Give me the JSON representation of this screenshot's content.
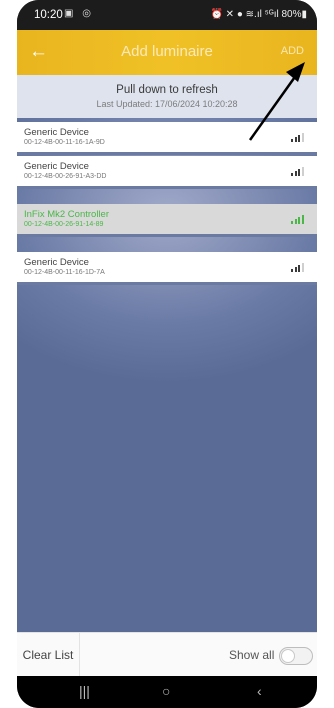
{
  "status_bar": {
    "time": "10:20",
    "icons_left": "▣ ◎",
    "icons_right": "⏰ ✕ ● ≋.ıl ⁵ᴳıl 80%▮",
    "battery": "80%"
  },
  "app_bar": {
    "back_icon": "←",
    "title": "Add luminaire",
    "add_label": "ADD",
    "color": "#eebc24"
  },
  "refresh_banner": {
    "line1": "Pull down to refresh",
    "line2": "Last Updated: 17/06/2024 10:20:28"
  },
  "devices": [
    {
      "name": "Generic Device",
      "mac": "00-12-4B-00-11-16-1A-9D",
      "signal_bars": 3,
      "selected": false
    },
    {
      "name": "Generic Device",
      "mac": "00-12-4B-00-26-91-A3-DD",
      "signal_bars": 3,
      "selected": false
    },
    {
      "name": "InFix Mk2 Controller",
      "mac": "00-12-4B-00-26-91-14-89",
      "signal_bars": 4,
      "selected": true
    },
    {
      "name": "Generic Device",
      "mac": "00-12-4B-00-11-16-1D-7A",
      "signal_bars": 3,
      "selected": false
    }
  ],
  "bottom_bar": {
    "clear_label": "Clear List",
    "show_all_label": "Show all",
    "show_all_on": false
  },
  "nav_bar": {
    "recent": "|||",
    "home": "○",
    "back": "‹"
  },
  "colors": {
    "accent": "#eebc24",
    "selected_text": "#4bb748",
    "signal_active": "#4bb748",
    "signal_dark": "#3a3a3a",
    "signal_off": "#cfcfcf"
  }
}
